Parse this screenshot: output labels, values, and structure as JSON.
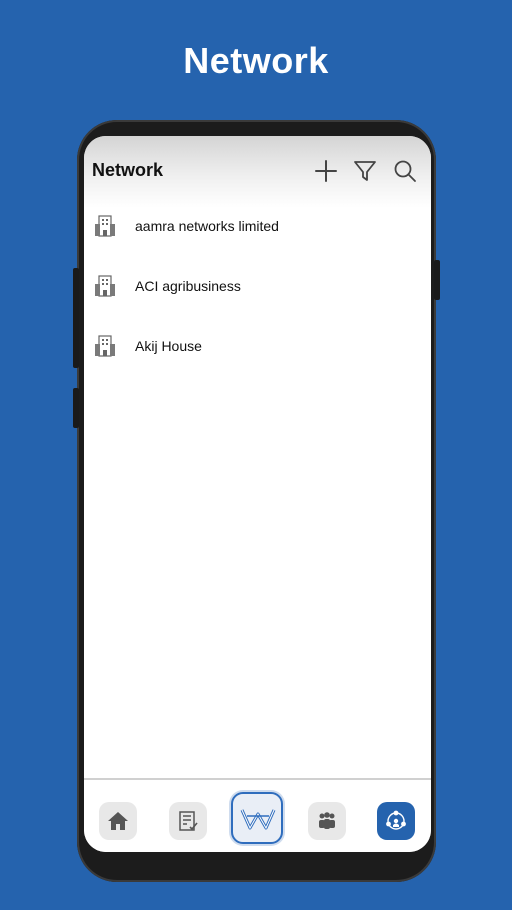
{
  "promo": {
    "title": "Network"
  },
  "header": {
    "title": "Network",
    "icons": [
      "plus-icon",
      "filter-icon",
      "search-icon"
    ]
  },
  "list": {
    "items": [
      {
        "label": "aamra networks limited",
        "icon": "building-icon"
      },
      {
        "label": "ACI agribusiness",
        "icon": "building-icon"
      },
      {
        "label": "Akij House",
        "icon": "building-icon"
      }
    ]
  },
  "bottom_nav": {
    "items": [
      {
        "icon": "home-icon"
      },
      {
        "icon": "document-check-icon"
      },
      {
        "icon": "w-logo-icon"
      },
      {
        "icon": "people-icon"
      },
      {
        "icon": "network-icon",
        "active": true
      }
    ]
  },
  "colors": {
    "background": "#2563ae",
    "accent": "#2563ae",
    "text": "#111111"
  }
}
